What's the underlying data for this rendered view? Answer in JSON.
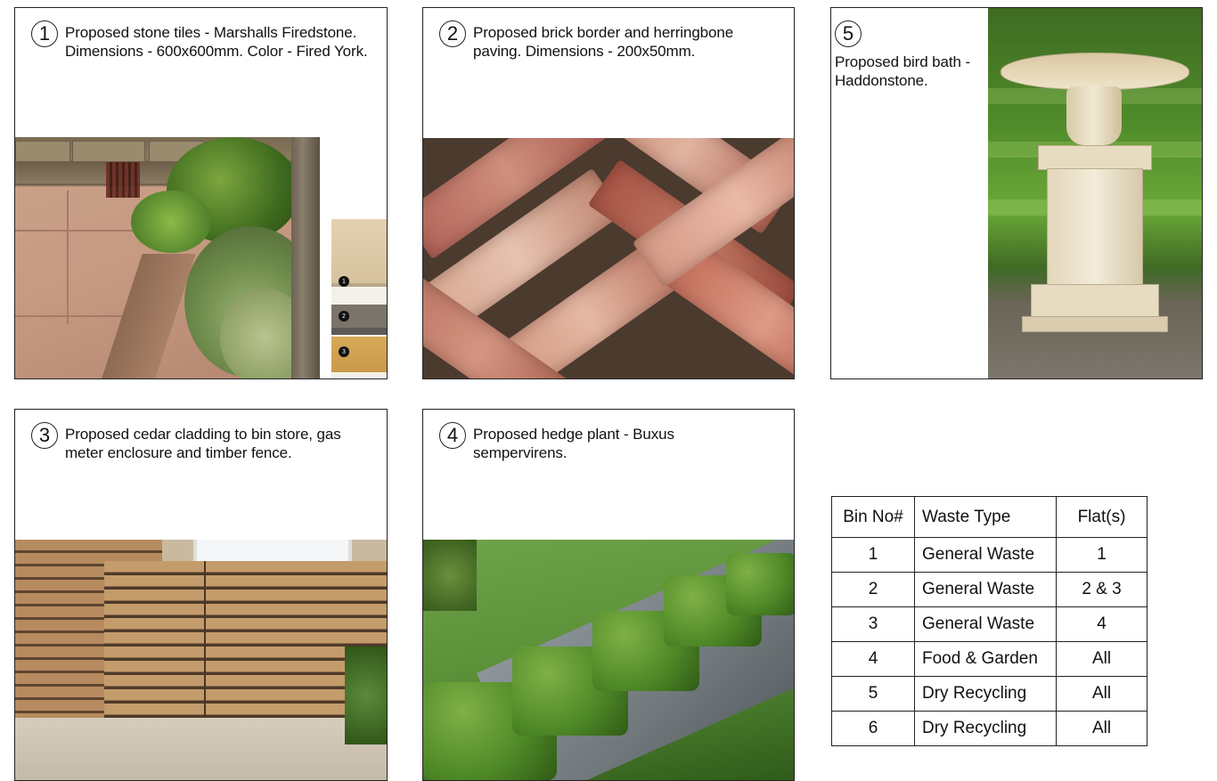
{
  "panels": {
    "p1": {
      "number": "1",
      "caption": "Proposed stone tiles - Marshalls Firedstone. Dimensions - 600x600mm. Color  - Fired York.",
      "swatch_dots": [
        "1",
        "2",
        "3"
      ]
    },
    "p2": {
      "number": "2",
      "caption": "Proposed brick border and herringbone paving. Dimensions - 200x50mm."
    },
    "p3": {
      "number": "3",
      "caption": "Proposed cedar cladding to bin store, gas meter enclosure and timber fence."
    },
    "p4": {
      "number": "4",
      "caption": "Proposed hedge plant - Buxus sempervirens."
    },
    "p5": {
      "number": "5",
      "caption": "Proposed bird bath - Haddonstone."
    }
  },
  "bin_table": {
    "headers": [
      "Bin No#",
      "Waste Type",
      "Flat(s)"
    ],
    "rows": [
      [
        "1",
        "General Waste",
        "1"
      ],
      [
        "2",
        "General Waste",
        "2 & 3"
      ],
      [
        "3",
        "General Waste",
        "4"
      ],
      [
        "4",
        "Food & Garden",
        "All"
      ],
      [
        "5",
        "Dry Recycling",
        "All"
      ],
      [
        "6",
        "Dry Recycling",
        "All"
      ]
    ]
  }
}
